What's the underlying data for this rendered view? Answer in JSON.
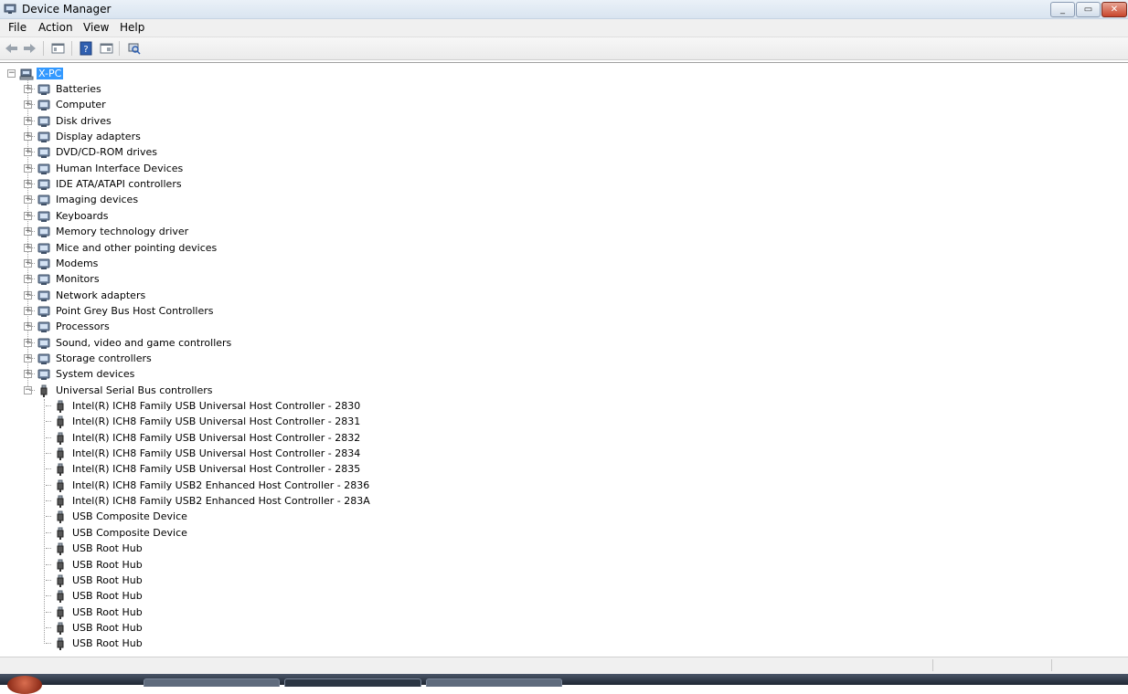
{
  "window": {
    "title": "Device Manager"
  },
  "menu": {
    "file": "File",
    "action": "Action",
    "view": "View",
    "help": "Help"
  },
  "tree": {
    "root": "X-PC",
    "categories": [
      "Batteries",
      "Computer",
      "Disk drives",
      "Display adapters",
      "DVD/CD-ROM drives",
      "Human Interface Devices",
      "IDE ATA/ATAPI controllers",
      "Imaging devices",
      "Keyboards",
      "Memory technology driver",
      "Mice and other pointing devices",
      "Modems",
      "Monitors",
      "Network adapters",
      "Point Grey Bus Host Controllers",
      "Processors",
      "Sound, video and game controllers",
      "Storage controllers",
      "System devices"
    ],
    "expanded": {
      "label": "Universal Serial Bus controllers",
      "children": [
        "Intel(R) ICH8 Family USB Universal Host Controller - 2830",
        "Intel(R) ICH8 Family USB Universal Host Controller - 2831",
        "Intel(R) ICH8 Family USB Universal Host Controller - 2832",
        "Intel(R) ICH8 Family USB Universal Host Controller - 2834",
        "Intel(R) ICH8 Family USB Universal Host Controller - 2835",
        "Intel(R) ICH8 Family USB2 Enhanced Host Controller - 2836",
        "Intel(R) ICH8 Family USB2 Enhanced Host Controller - 283A",
        "USB Composite Device",
        "USB Composite Device",
        "USB Root Hub",
        "USB Root Hub",
        "USB Root Hub",
        "USB Root Hub",
        "USB Root Hub",
        "USB Root Hub",
        "USB Root Hub"
      ]
    }
  },
  "icons": {
    "root": "computer-network-icon",
    "categories": [
      "battery-icon",
      "computer-icon",
      "disk-drive-icon",
      "display-adapter-icon",
      "dvd-drive-icon",
      "hid-icon",
      "ide-controller-icon",
      "imaging-device-icon",
      "keyboard-icon",
      "memory-icon",
      "mouse-icon",
      "modem-icon",
      "monitor-icon",
      "network-adapter-icon",
      "bus-host-controller-icon",
      "processor-icon",
      "sound-icon",
      "storage-controller-icon",
      "system-device-icon"
    ],
    "usb": "usb-plug-icon"
  },
  "colors": {
    "selection": "#3399ff",
    "close_button": "#c8452c"
  }
}
